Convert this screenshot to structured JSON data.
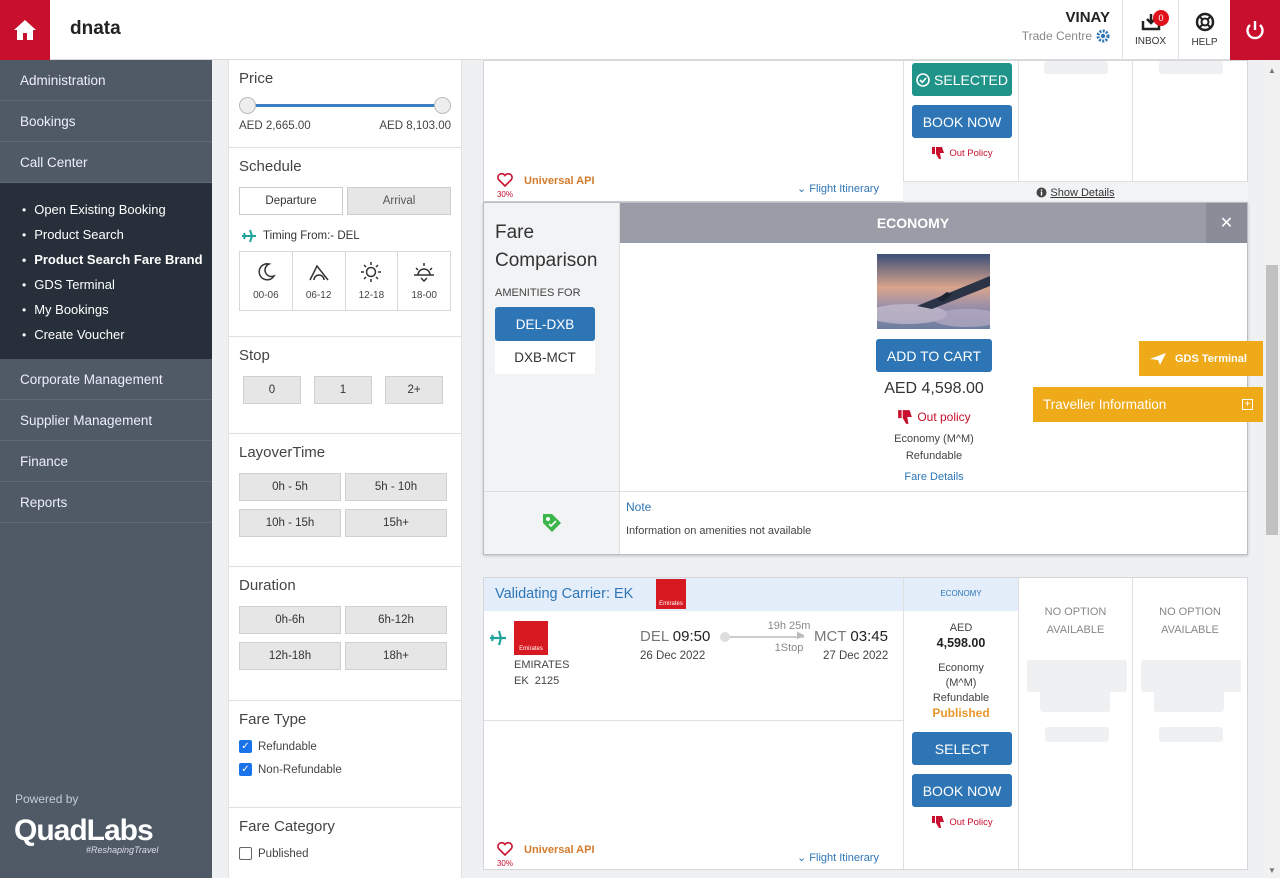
{
  "header": {
    "brand": "dnata",
    "user_name": "VINAY",
    "user_location": "Trade Centre",
    "inbox_label": "INBOX",
    "inbox_count": "0",
    "help_label": "HELP"
  },
  "sidebar": {
    "items_top": [
      "Administration",
      "Bookings",
      "Call Center"
    ],
    "sub_items": [
      "Open Existing Booking",
      "Product Search",
      "Product Search Fare Brand",
      "GDS Terminal",
      "My Bookings",
      "Create Voucher"
    ],
    "items_bottom": [
      "Corporate Management",
      "Supplier Management",
      "Finance",
      "Reports"
    ],
    "powered_by": "Powered by",
    "logo_text": "QuadLabs",
    "logo_tagline": "#ReshapingTravel"
  },
  "filters": {
    "price": {
      "title": "Price",
      "min": "AED 2,665.00",
      "max": "AED 8,103.00"
    },
    "schedule": {
      "title": "Schedule",
      "departure": "Departure",
      "arrival": "Arrival",
      "timing_from": "Timing From:- DEL",
      "slots": [
        "00-06",
        "06-12",
        "12-18",
        "18-00"
      ]
    },
    "stop": {
      "title": "Stop",
      "options": [
        "0",
        "1",
        "2+"
      ]
    },
    "layover": {
      "title": "LayoverTime",
      "options": [
        "0h - 5h",
        "5h - 10h",
        "10h - 15h",
        "15h+"
      ]
    },
    "duration": {
      "title": "Duration",
      "options": [
        "0h-6h",
        "6h-12h",
        "12h-18h",
        "18h+"
      ]
    },
    "fare_type": {
      "title": "Fare Type",
      "options": [
        "Refundable",
        "Non-Refundable"
      ]
    },
    "fare_category": {
      "title": "Fare Category",
      "options": [
        "Published"
      ]
    }
  },
  "result_top": {
    "selected_label": "SELECTED",
    "book_now": "BOOK NOW",
    "out_policy": "Out Policy",
    "source": "Universal API",
    "percent": "30%",
    "itinerary": "Flight Itinerary",
    "show_details": "Show Details"
  },
  "fare_comparison": {
    "title": "Fare Comparison",
    "amenities_for": "AMENITIES FOR",
    "routes": [
      "DEL-DXB",
      "DXB-MCT"
    ],
    "cabin": "ECONOMY",
    "close": "✕",
    "add_to_cart": "ADD TO CART",
    "price": "AED 4,598.00",
    "out_policy": "Out policy",
    "class": "Economy (M^M)",
    "refund": "Refundable",
    "fare_details": "Fare Details",
    "note_title": "Note",
    "note_text": "Information on amenities not available"
  },
  "floating": {
    "gds_terminal": "GDS Terminal",
    "traveller_info": "Traveller Information"
  },
  "result_card": {
    "validating": "Validating Carrier: EK",
    "logo_text": "Emirates",
    "airline": "EMIRATES",
    "flight_no": "EK  2125",
    "dep_code": "DEL",
    "dep_time": "09:50",
    "dep_date": "26 Dec 2022",
    "duration": "19h 25m",
    "stops": "1Stop",
    "arr_code": "MCT",
    "arr_time": "03:45",
    "arr_date": "27 Dec 2022",
    "cabin": "ECONOMY",
    "currency": "AED",
    "price": "4,598.00",
    "class_1": "Economy",
    "class_2": "(M^M)",
    "refund": "Refundable",
    "published": "Published",
    "select": "SELECT",
    "book_now": "BOOK NOW",
    "out_policy": "Out Policy",
    "no_option_1": "NO OPTION",
    "no_option_2": "AVAILABLE",
    "source": "Universal API",
    "percent": "30%",
    "itinerary": "Flight Itinerary"
  },
  "colors": {
    "brand_red": "#c8102e",
    "sidebar": "#505a66",
    "blue": "#2e75b6",
    "teal": "#21948a",
    "amber": "#eeaa18"
  }
}
